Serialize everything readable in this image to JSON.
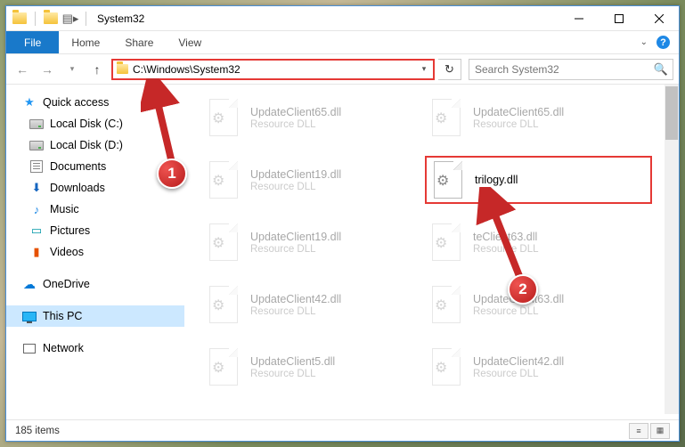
{
  "window": {
    "title": "System32"
  },
  "ribbon": {
    "file": "File",
    "tabs": [
      "Home",
      "Share",
      "View"
    ]
  },
  "address": {
    "path": "C:\\Windows\\System32",
    "search_placeholder": "Search System32"
  },
  "sidebar": {
    "quick_access": "Quick access",
    "items": [
      {
        "label": "Local Disk (C:)"
      },
      {
        "label": "Local Disk (D:)"
      },
      {
        "label": "Documents"
      },
      {
        "label": "Downloads"
      },
      {
        "label": "Music"
      },
      {
        "label": "Pictures"
      },
      {
        "label": "Videos"
      }
    ],
    "onedrive": "OneDrive",
    "thispc": "This PC",
    "network": "Network"
  },
  "files": {
    "sub": "Resource DLL",
    "col1": [
      {
        "name": "UpdateClient65.dll"
      },
      {
        "name": "UpdateClient19.dll"
      },
      {
        "name": "UpdateClient19.dll"
      },
      {
        "name": "UpdateClient42.dll"
      },
      {
        "name": "UpdateClient5.dll"
      }
    ],
    "col2": [
      {
        "name": "UpdateClient65.dll"
      },
      {
        "name": "trilogy.dll",
        "highlight": true,
        "nosub": true
      },
      {
        "name": "teClient63.dll"
      },
      {
        "name": "UpdateClient63.dll"
      },
      {
        "name": "UpdateClient42.dll"
      }
    ]
  },
  "status": {
    "count": "185 items"
  },
  "callouts": {
    "one": "1",
    "two": "2"
  }
}
